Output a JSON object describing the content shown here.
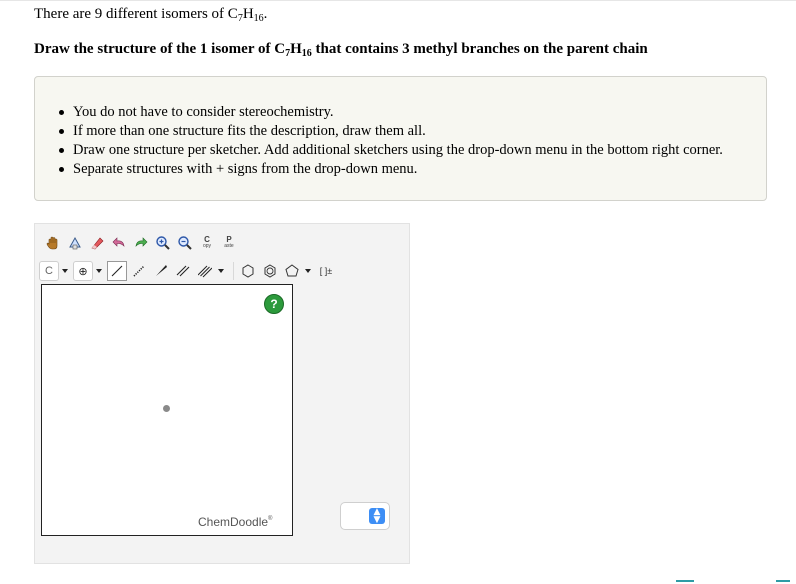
{
  "intro": {
    "prefix": "There are 9 different isomers of C",
    "sub1": "7",
    "mid": "H",
    "sub2": "16",
    "suffix": "."
  },
  "question": {
    "prefix": "Draw the structure of the 1 isomer of C",
    "sub1": "7",
    "mid": "H",
    "sub2": "16",
    "suffix": " that contains 3 methyl branches on the parent chain"
  },
  "hints": [
    "You do not have to consider stereochemistry.",
    "If more than one structure fits the description, draw them all.",
    "Draw one structure per sketcher. Add additional sketchers using the drop-down menu in the bottom right corner.",
    "Separate structures with + signs from the drop-down menu."
  ],
  "toolbar": {
    "copy_top": "C",
    "copy_bottom": "opy",
    "paste_top": "P",
    "paste_bottom": "aste",
    "element_label": "C",
    "charge_label": "⊕",
    "bracket_label": "[ ]±"
  },
  "canvas": {
    "help_label": "?",
    "brand": "ChemDoodle",
    "brand_mark": "®"
  },
  "stepper": {
    "arrows_up": "▲",
    "arrows_down": "▼"
  },
  "colors": {
    "help_green": "#2c9a3c",
    "stepper_blue": "#3d8ef5",
    "hint_bg": "#f7f7f1"
  }
}
